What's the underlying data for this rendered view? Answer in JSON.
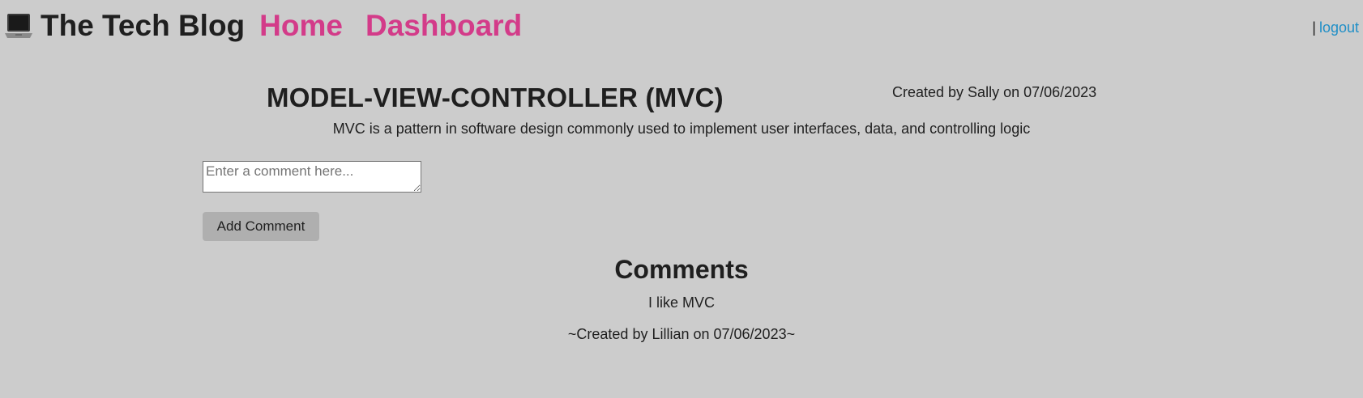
{
  "header": {
    "site_title": "The Tech Blog",
    "nav": {
      "home": "Home",
      "dashboard": "Dashboard"
    },
    "separator": "|",
    "logout": "logout",
    "logo_icon": "laptop-icon"
  },
  "post": {
    "title": "MODEL-VIEW-CONTROLLER (MVC)",
    "meta": "Created by Sally on 07/06/2023",
    "body": "MVC is a pattern in software design commonly used to implement user interfaces, data, and controlling logic"
  },
  "comment_form": {
    "placeholder": "Enter a comment here...",
    "submit_label": "Add Comment"
  },
  "comments": {
    "heading": "Comments",
    "items": [
      {
        "text": "I like MVC",
        "meta": "~Created by Lillian on 07/06/2023~"
      }
    ]
  },
  "colors": {
    "background": "#cccccc",
    "nav_link": "#d33b89",
    "logout_link": "#1f8fc7",
    "button": "#afafaf"
  }
}
